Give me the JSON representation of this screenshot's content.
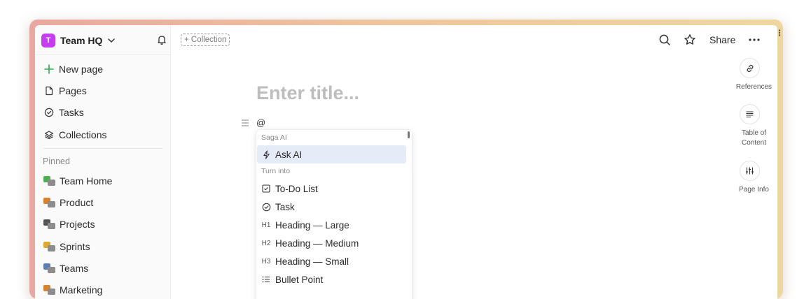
{
  "workspace": {
    "initial": "T",
    "name": "Team HQ",
    "badge_color": "#c63df0"
  },
  "nav": [
    {
      "label": "New page",
      "icon": "plus-icon"
    },
    {
      "label": "Pages",
      "icon": "document-icon"
    },
    {
      "label": "Tasks",
      "icon": "check-circle-icon"
    },
    {
      "label": "Collections",
      "icon": "layers-icon"
    }
  ],
  "pinned": {
    "label": "Pinned",
    "items": [
      {
        "label": "Team Home",
        "color": "#4caf50"
      },
      {
        "label": "Product",
        "color": "#d9822b"
      },
      {
        "label": "Projects",
        "color": "#555555"
      },
      {
        "label": "Sprints",
        "color": "#e0a82e"
      },
      {
        "label": "Teams",
        "color": "#5b7fb8"
      },
      {
        "label": "Marketing",
        "color": "#d9822b"
      }
    ]
  },
  "toolbar": {
    "collection_label": "+ Collection",
    "share_label": "Share"
  },
  "editor": {
    "title_placeholder": "Enter title...",
    "typed": "@"
  },
  "menu": {
    "section_ai": "Saga AI",
    "ai_item": "Ask AI",
    "section_turn": "Turn into",
    "items": [
      {
        "label": "To-Do List",
        "icon": "checkbox-icon"
      },
      {
        "label": "Task",
        "icon": "check-circle-icon"
      },
      {
        "label": "Heading — Large",
        "icon": "h1-icon",
        "glyph": "H1"
      },
      {
        "label": "Heading — Medium",
        "icon": "h2-icon",
        "glyph": "H2"
      },
      {
        "label": "Heading — Small",
        "icon": "h3-icon",
        "glyph": "H3"
      },
      {
        "label": "Bullet Point",
        "icon": "list-icon"
      }
    ]
  },
  "rail": [
    {
      "label": "References",
      "icon": "link-icon"
    },
    {
      "label": "Table of Content",
      "icon": "toc-icon"
    },
    {
      "label": "Page Info",
      "icon": "sliders-icon"
    }
  ],
  "colors": {
    "accent_active": "#e5ecf7",
    "new_page_green": "#2fa84f"
  }
}
